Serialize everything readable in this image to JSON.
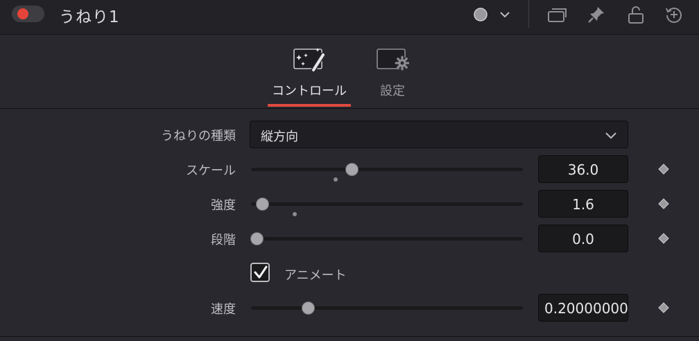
{
  "header": {
    "title": "うねり1",
    "toggle_enabled": true,
    "toggle_color": "#e5443a",
    "icons": [
      "color-dot-icon",
      "chevron-down-icon",
      "copy-windows-icon",
      "pin-icon",
      "lock-icon",
      "reset-history-icon"
    ]
  },
  "tabs": [
    {
      "label": "コントロール",
      "icon": "magic-wand-icon",
      "active": true
    },
    {
      "label": "設定",
      "icon": "settings-gear-icon",
      "active": false
    }
  ],
  "params": {
    "type": {
      "label": "うねりの種類",
      "value": "縦方向"
    },
    "scale": {
      "label": "スケール",
      "value": "36.0",
      "slider_fraction": 0.37,
      "default_fraction": 0.31
    },
    "strength": {
      "label": "強度",
      "value": "1.6",
      "slider_fraction": 0.04,
      "default_fraction": 0.16
    },
    "steps": {
      "label": "段階",
      "value": "0.0",
      "slider_fraction": 0.02
    },
    "animate": {
      "label": "アニメート",
      "checked": true
    },
    "speed": {
      "label": "速度",
      "value": "0.20000000",
      "slider_fraction": 0.21
    }
  },
  "colors": {
    "accent": "#e04a3f",
    "panel": "#28282e",
    "header": "#232327"
  }
}
